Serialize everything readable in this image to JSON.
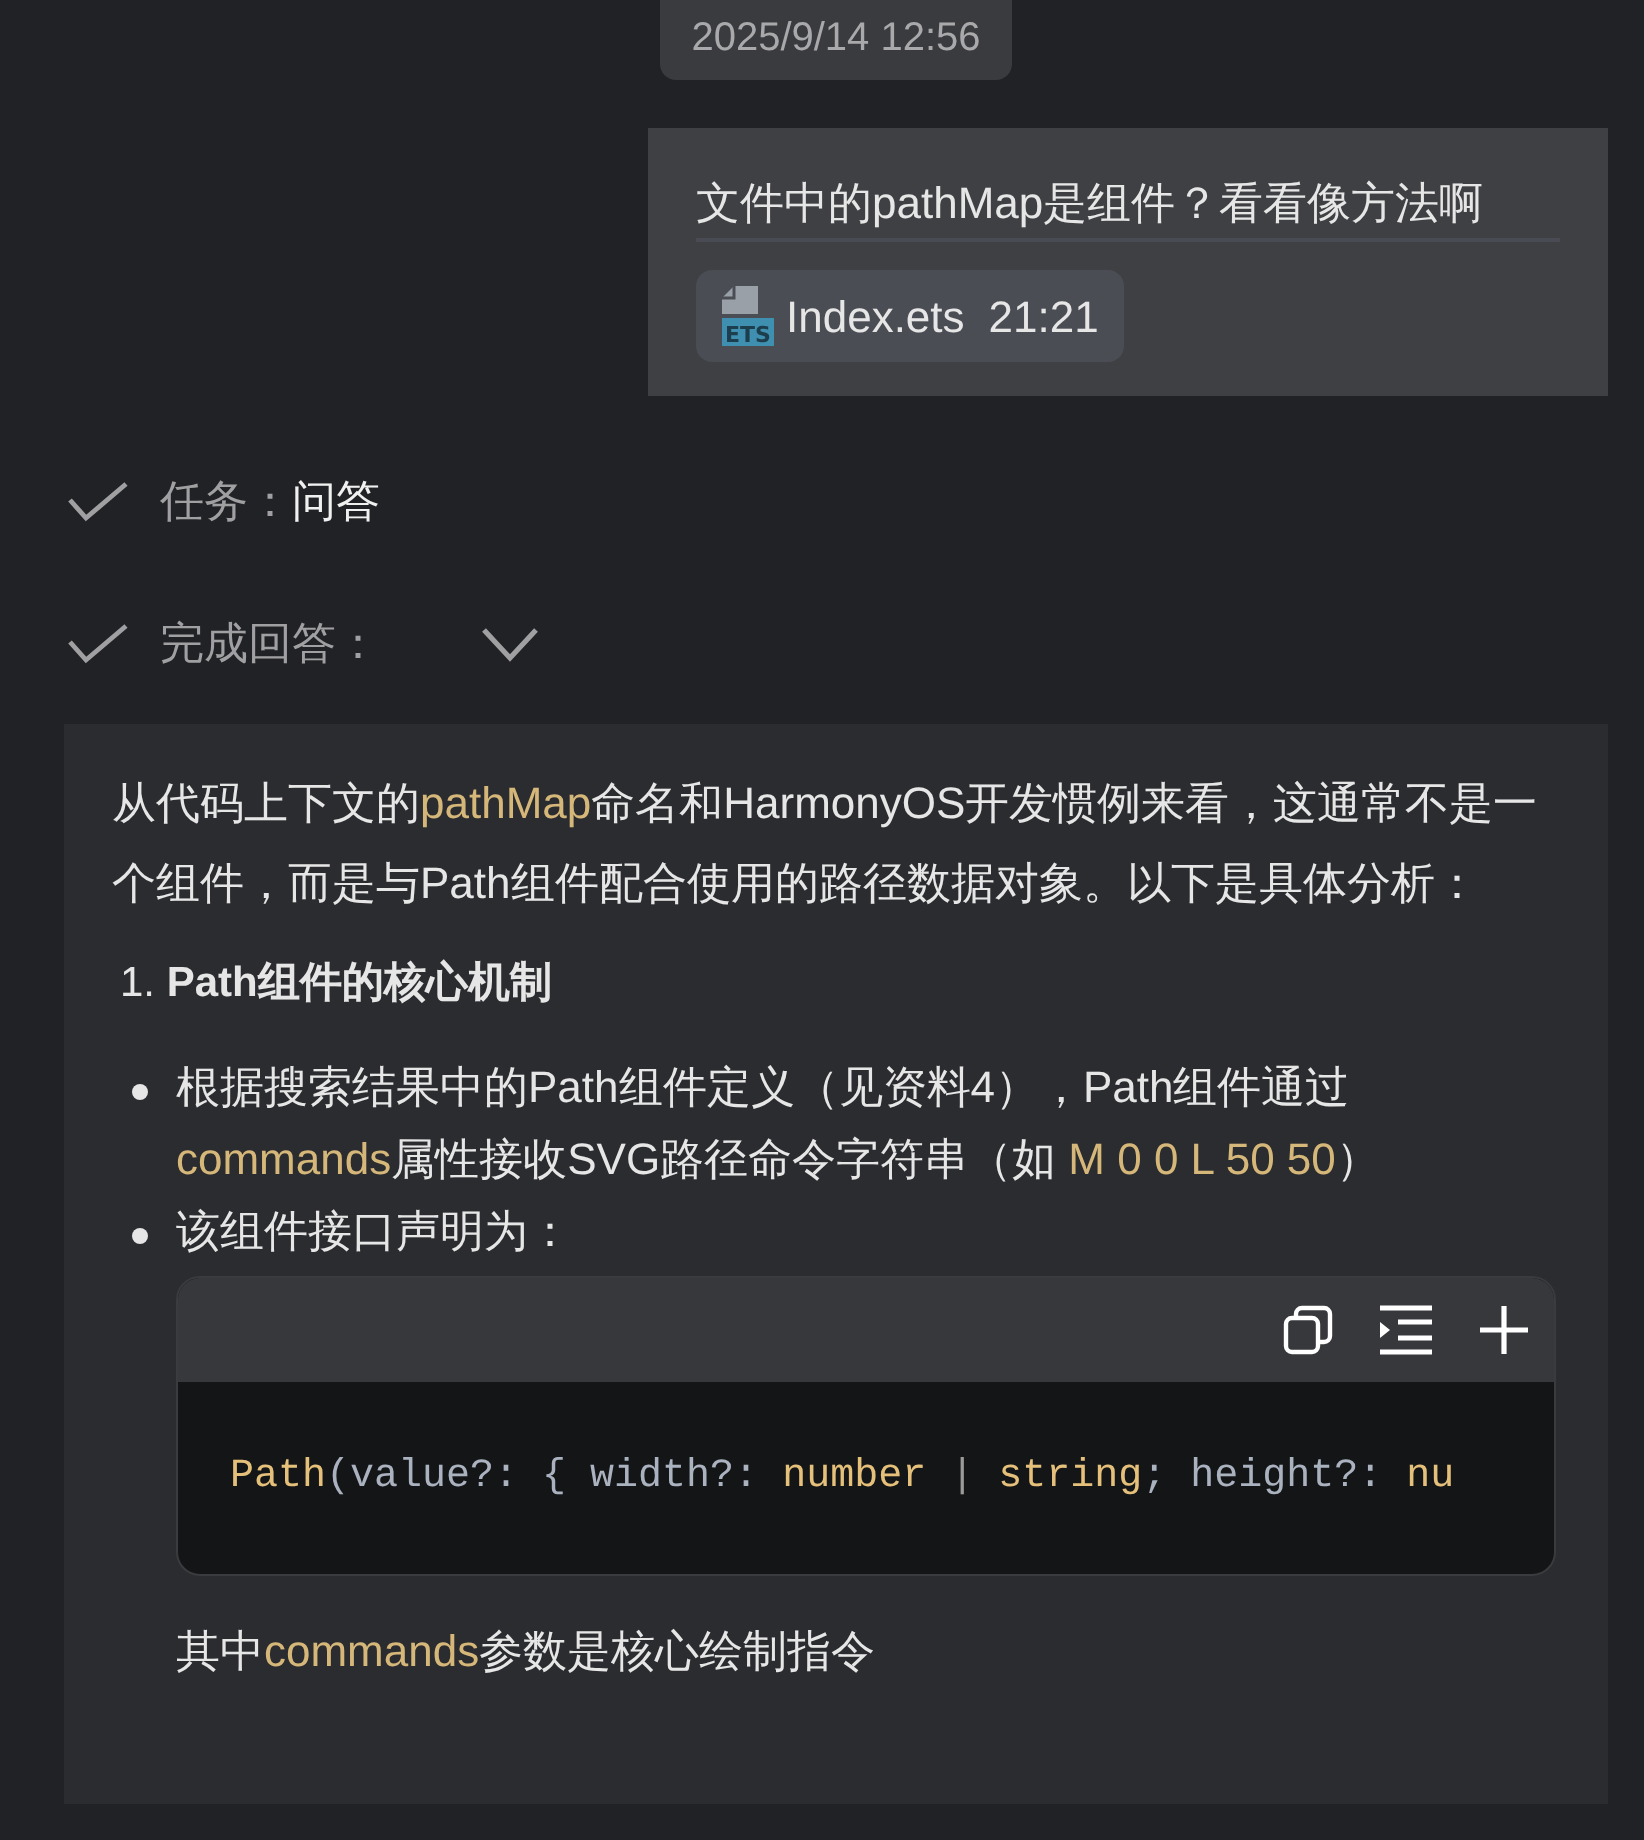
{
  "timestamp": "2025/9/14 12:56",
  "user_message": {
    "text": "文件中的pathMap是组件？看看像方法啊",
    "attachment": {
      "file_type": "ETS",
      "name": "Index.ets",
      "position": "21:21"
    }
  },
  "steps": [
    {
      "label": "任务：",
      "value": "问答"
    },
    {
      "label": "完成回答：",
      "expanded": true
    }
  ],
  "answer": {
    "intro": [
      {
        "kind": "plain",
        "text": "从代码上下文的"
      },
      {
        "kind": "code",
        "text": "pathMap"
      },
      {
        "kind": "plain",
        "text": "命名和HarmonyOS开发惯例来看，这通常不是一个组件，而是与Path组件配合使用的路径数据对象。以下是具体分析："
      }
    ],
    "section": {
      "number": "1.",
      "title": "Path组件的核心机制"
    },
    "bullets": [
      [
        {
          "kind": "plain",
          "text": "根据搜索结果中的Path组件定义（见资料4），Path组件通过"
        },
        {
          "kind": "code",
          "text": "commands"
        },
        {
          "kind": "plain",
          "text": "属性接收SVG路径命令字符串（如 "
        },
        {
          "kind": "code",
          "text": "M 0 0 L 50 50"
        },
        {
          "kind": "plain",
          "text": "）"
        }
      ],
      [
        {
          "kind": "plain",
          "text": "该组件接口声明为："
        }
      ]
    ],
    "code_block": {
      "tokens": [
        {
          "kind": "type",
          "text": "Path"
        },
        {
          "kind": "text",
          "text": "(value?: { width?: "
        },
        {
          "kind": "type",
          "text": "number"
        },
        {
          "kind": "punct",
          "text": " | "
        },
        {
          "kind": "type",
          "text": "string"
        },
        {
          "kind": "text",
          "text": "; height?: "
        },
        {
          "kind": "type",
          "text": "nu"
        }
      ]
    },
    "outro": [
      {
        "kind": "plain",
        "text": "其中"
      },
      {
        "kind": "code",
        "text": "commands"
      },
      {
        "kind": "plain",
        "text": "参数是核心绘制指令"
      }
    ]
  }
}
